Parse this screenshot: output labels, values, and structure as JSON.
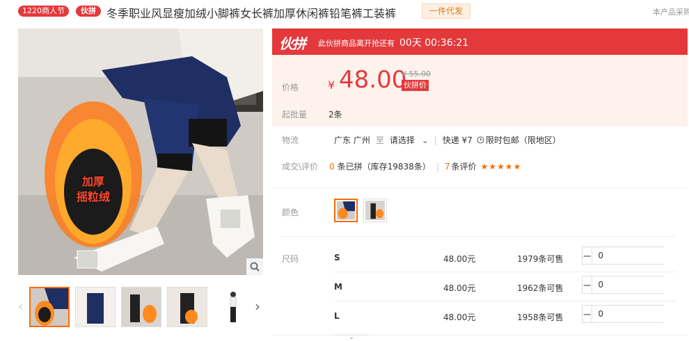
{
  "header": {
    "festival_badge": "1220商人节",
    "group_badge": "伙拼",
    "product_title": "冬季职业风显瘦加绒小脚裤女长裤加厚休闲裤铅笔裤工装裤",
    "dropship_tag": "一件代发",
    "collect_link": "本产品采购"
  },
  "gallery": {
    "overlay_text": "加厚\n摇粒绒",
    "thumbnail_count": 5,
    "active_thumbnail": 0
  },
  "promo": {
    "logo": "伙拼",
    "text": "此伙拼商品离开抢还有",
    "timer": "00天 00:36:21"
  },
  "price": {
    "label": "价格",
    "currency": "¥",
    "value": "48.00",
    "old_price": "¥ 55.00",
    "group_price_tag": "伙拼价",
    "moq_label": "起批量",
    "moq_value": "2条"
  },
  "logistics": {
    "label": "物流",
    "origin": "广东 广州",
    "to": "至",
    "destination": "请选择",
    "express": "快递 ¥7",
    "free_shipping": "限时包邮（限地区）"
  },
  "reviews": {
    "label": "成交\\评价",
    "sold_count": "0",
    "sold_text": "条已拼（库存19838条）",
    "review_count": "7",
    "review_text": "条评价",
    "rating": 5,
    "stars": "★★★★★"
  },
  "colors": {
    "label": "颜色",
    "selected_index": 0
  },
  "sizes": {
    "label": "尺码",
    "rows": [
      {
        "name": "S",
        "price": "48.00元",
        "stock": "1979条可售",
        "qty": "0"
      },
      {
        "name": "M",
        "price": "48.00元",
        "stock": "1962条可售",
        "qty": "0"
      },
      {
        "name": "L",
        "price": "48.00元",
        "stock": "1958条可售",
        "qty": "0"
      }
    ]
  },
  "theme": {
    "brand_red": "#e4393c",
    "accent_orange": "#ff6a00",
    "price_bg": "#fdf3ec"
  }
}
